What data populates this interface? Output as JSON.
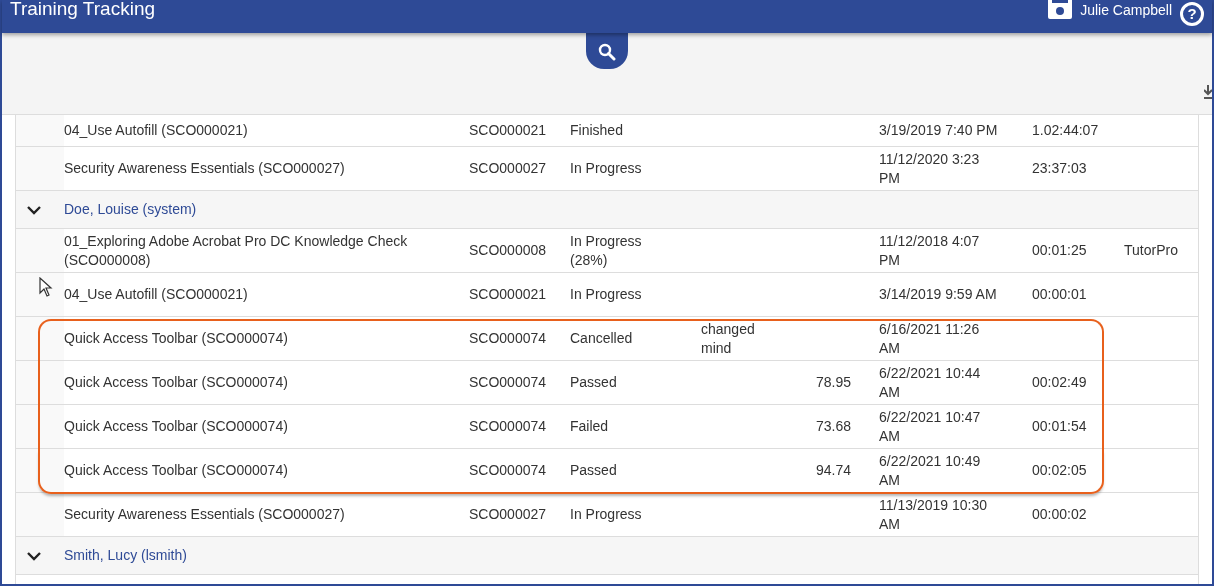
{
  "header": {
    "title": "Training Tracking",
    "user": "Julie Campbell",
    "help": "?"
  },
  "rows": [
    {
      "kind": "record",
      "name": "04_Use Autofill (SCO000021)",
      "code": "SCO000021",
      "status": "Finished",
      "date": "3/19/2019 7:40 PM",
      "duration": "1.02:44:07",
      "highlighted": false
    },
    {
      "kind": "record",
      "name": "Security Awareness Essentials (SCO000027)",
      "code": "SCO000027",
      "status": "In Progress",
      "date": "11/12/2020 3:23 PM",
      "duration": "23:37:03",
      "highlighted": false
    },
    {
      "kind": "group",
      "label": "Doe, Louise (system)",
      "expanded": true
    },
    {
      "kind": "record",
      "name": "01_Exploring Adobe Acrobat Pro DC Knowledge Check (SCO000008)",
      "code": "SCO000008",
      "status": "In Progress (28%)",
      "date": "11/12/2018 4:07 PM",
      "duration": "00:01:25",
      "tool": "TutorPro",
      "highlighted": false
    },
    {
      "kind": "record",
      "name": "04_Use Autofill (SCO000021)",
      "code": "SCO000021",
      "status": "In Progress",
      "date": "3/14/2019 9:59 AM",
      "duration": "00:00:01",
      "highlighted": false
    },
    {
      "kind": "record",
      "name": "Quick Access Toolbar (SCO000074)",
      "code": "SCO000074",
      "status": "Cancelled",
      "comment": "changed mind",
      "date": "6/16/2021 11:26 AM",
      "highlighted": true
    },
    {
      "kind": "record",
      "name": "Quick Access Toolbar (SCO000074)",
      "code": "SCO000074",
      "status": "Passed",
      "score": "78.95",
      "date": "6/22/2021 10:44 AM",
      "duration": "00:02:49",
      "highlighted": true
    },
    {
      "kind": "record",
      "name": "Quick Access Toolbar (SCO000074)",
      "code": "SCO000074",
      "status": "Failed",
      "score": "73.68",
      "date": "6/22/2021 10:47 AM",
      "duration": "00:01:54",
      "highlighted": true
    },
    {
      "kind": "record",
      "name": "Quick Access Toolbar (SCO000074)",
      "code": "SCO000074",
      "status": "Passed",
      "score": "94.74",
      "date": "6/22/2021 10:49 AM",
      "duration": "00:02:05",
      "highlighted": true
    },
    {
      "kind": "record",
      "name": "Security Awareness Essentials (SCO000027)",
      "code": "SCO000027",
      "status": "In Progress",
      "date": "11/13/2019 10:30 AM",
      "duration": "00:00:02",
      "highlighted": false
    },
    {
      "kind": "group",
      "label": "Smith, Lucy (lsmith)",
      "expanded": true
    }
  ]
}
